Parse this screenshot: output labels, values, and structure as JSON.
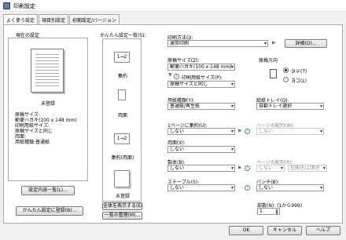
{
  "window": {
    "title": "印刷設定"
  },
  "tabs": [
    "よく使う設定",
    "項目別設定",
    "初期設定/バージョン"
  ],
  "current": {
    "heading": "現在の設定",
    "preset_name": "未登録",
    "summary": [
      "原稿サイズ:",
      "郵便ハガキ(100 x 148 mm)",
      "印刷用紙サイズ:",
      "原稿サイズと同じ",
      "両面:",
      "用紙種類:",
      "普通紙"
    ],
    "summary_display": [
      "原稿サイズ:",
      "  郵便ハガキ(100 x 148 mm)",
      "印刷用紙サイズ:",
      "  原稿サイズと同じ",
      "両面:",
      "  用紙種類:普通紙"
    ],
    "detail_button": "設定内容一覧(L)...",
    "register_button": "かんたん設定に登録(B)..."
  },
  "easy": {
    "heading": "かんたん設定一覧(S):",
    "items": [
      {
        "label": "集約",
        "icon": "1→2"
      },
      {
        "label": "両面",
        "icon": ""
      },
      {
        "label": "集約(両面)",
        "icon": "1→2"
      },
      {
        "label": "未登録",
        "icon": ""
      }
    ],
    "show_all_button": "全体を表示する(E)",
    "manage_button": "一覧の整理(M)..."
  },
  "right": {
    "print_method_label": "印刷方法(J):",
    "print_method": "通常印刷",
    "detail_button": "詳細(D)...",
    "original_size_label": "原稿サイズ(Z):",
    "original_size": "郵便ハガキ(100 x 148 mm)",
    "paper_size_label": "印刷用紙サイズ(P):",
    "paper_size": "原稿サイズと同じ",
    "orientation_label": "原稿方向",
    "orientation_options": [
      "タテ(T)",
      "ヨコ(L)"
    ],
    "paper_type_label": "用紙種類(Y):",
    "paper_type": "普通紙/再生紙",
    "tray_label": "給紙トレイ(Q):",
    "tray": "自動トレイ選択",
    "nup_label": "1ページに集約(U):",
    "nup": "しない",
    "page_order_label": "ページの配列(W):",
    "page_order": "しない",
    "duplex_label": "両面(X):",
    "duplex": "しない",
    "binding_label": "製本(B):",
    "binding": "しない",
    "layout_label": "ページの配列(R):",
    "layout_style": "しない",
    "layout_dir": "左開き/上開き",
    "staple_label": "ステープル(S):",
    "staple": "しない",
    "punch_label": "パンチ(B):",
    "punch": "しない",
    "copies_label": "部数(N): (1から999)",
    "copies": "1"
  },
  "buttons": {
    "ok": "OK",
    "cancel": "キャンセル",
    "help": "ヘルプ"
  }
}
